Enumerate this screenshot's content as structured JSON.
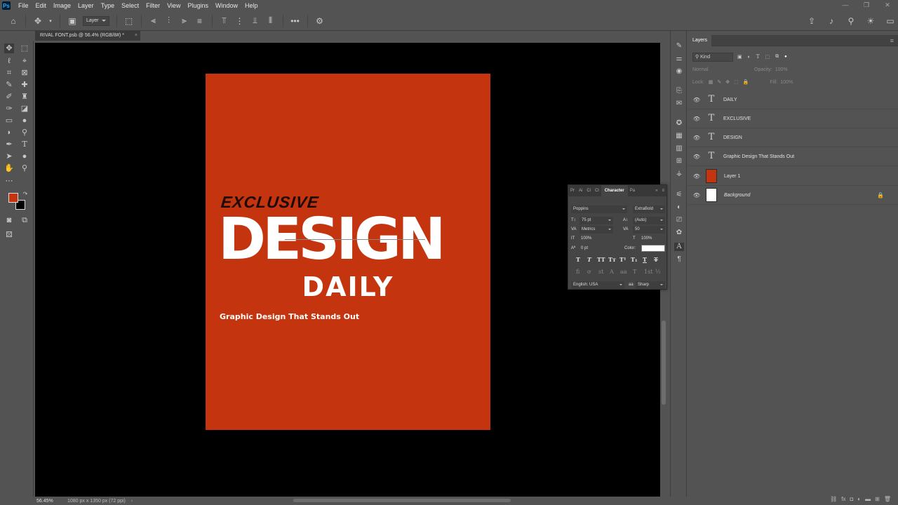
{
  "app": {
    "name": "Ps",
    "menu": [
      "File",
      "Edit",
      "Image",
      "Layer",
      "Type",
      "Select",
      "Filter",
      "View",
      "Plugins",
      "Window",
      "Help"
    ]
  },
  "window_controls": {
    "minimize": "—",
    "restore": "❐",
    "close": "✕"
  },
  "options_bar": {
    "auto_select_target": "Layer"
  },
  "document": {
    "tab_title": "RIVAL FONT.psb @ 56.4% (RGB/8#) *",
    "close": "×"
  },
  "artwork": {
    "exclusive": "EXCLUSIVE",
    "design": "DESIGN",
    "daily": "DAILY",
    "tagline": "Graphic Design That Stands Out",
    "background_color": "#c3340f"
  },
  "status": {
    "zoom": "56.45%",
    "doc_info": "1080 px x 1350 px (72 ppi)"
  },
  "layers_panel": {
    "title": "Layers",
    "filter_kind": "Kind",
    "blend_mode": "Normal",
    "opacity_label": "Opacity:",
    "opacity_value": "100%",
    "lock_label": "Lock:",
    "fill_label": "Fill:",
    "fill_value": "100%",
    "layers": [
      {
        "name": "DAILY",
        "type": "text"
      },
      {
        "name": "EXCLUSIVE",
        "type": "text"
      },
      {
        "name": "DESIGN",
        "type": "text"
      },
      {
        "name": "Graphic Design That Stands Out",
        "type": "text"
      },
      {
        "name": "Layer 1",
        "type": "pixel",
        "thumb_color": "#c3340f"
      },
      {
        "name": "Background",
        "type": "pixel",
        "thumb_color": "#ffffff",
        "locked": true
      }
    ]
  },
  "character_panel": {
    "tabs": [
      "Pr",
      "Ai",
      "Ci",
      "Cl",
      "Character",
      "Pa"
    ],
    "font_family": "Poppins",
    "font_style": "ExtraBold",
    "font_size": "75 pt",
    "leading": "(Auto)",
    "kerning": "Metrics",
    "tracking": "50",
    "vertical_scale": "100%",
    "horizontal_scale": "100%",
    "baseline_shift": "0 pt",
    "color_label": "Color:",
    "color_value": "#ffffff",
    "language": "English: USA",
    "antialias": "Sharp"
  }
}
